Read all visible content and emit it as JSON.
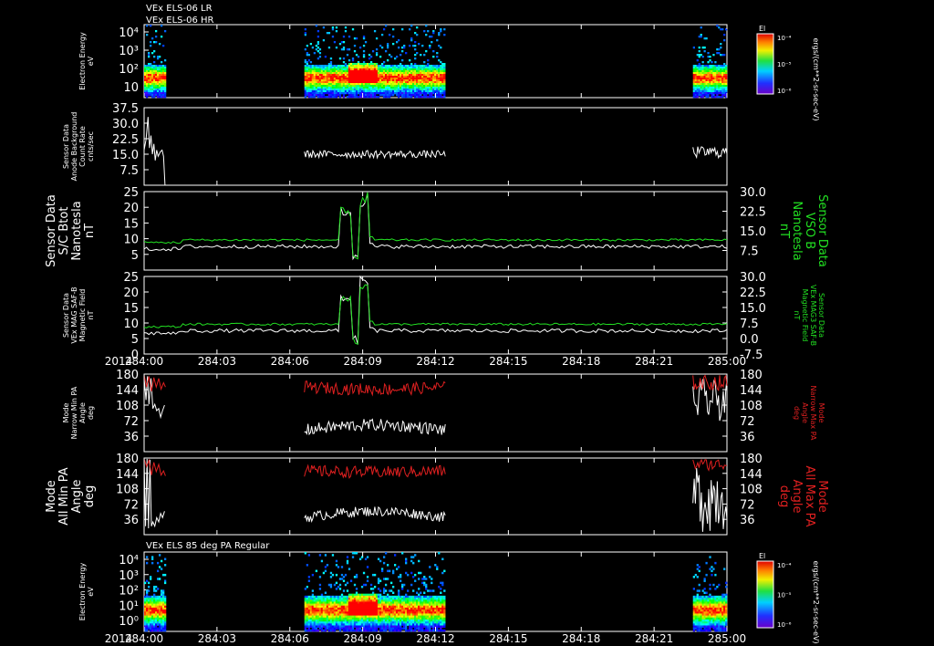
{
  "header": {
    "lines": [
      "VEx ELS-06 LR",
      "VEx ELS-06 HR"
    ]
  },
  "cbar_unit": "ergs/(cm**2-sr-sec-eV)",
  "cbar_label": "El",
  "cbar_ticks": [
    "10⁻⁴",
    "10⁻⁵",
    "10⁻⁶"
  ],
  "time_axis": {
    "year": "2014",
    "ticks": [
      "284:00",
      "284:03",
      "284:06",
      "284:09",
      "284:12",
      "284:15",
      "284:18",
      "284:21",
      "285:00"
    ]
  },
  "chart_data": [
    {
      "type": "heatmap",
      "name": "spec-top",
      "ylabel": [
        "Electron Energy",
        "eV"
      ],
      "log_y": true,
      "yticks": [
        "10⁴",
        "10³",
        "10²",
        "10"
      ],
      "colorscale": "rainbow",
      "segments": [
        [
          0,
          4.5
        ],
        [
          33,
          62
        ],
        [
          113,
          120
        ]
      ]
    },
    {
      "type": "line",
      "name": "bkg",
      "ylabel": [
        "Sensor Data",
        "Anode Background",
        "Count Rate",
        "cnts/sec"
      ],
      "ylim": [
        0,
        37.5
      ],
      "yticks": [
        "37.5",
        "30.0",
        "22.5",
        "15.0",
        "7.5"
      ],
      "ytick_values": [
        37.5,
        30,
        22.5,
        15,
        7.5
      ],
      "series": [
        {
          "color": "#ffffff",
          "segments": [
            {
              "x0": 0,
              "x1": 4.5,
              "points": [
                [
                  0,
                  17
                ],
                [
                  0.4,
                  22
                ],
                [
                  0.8,
                  33
                ],
                [
                  1.1,
                  18
                ],
                [
                  1.4,
                  24
                ],
                [
                  1.7,
                  15
                ],
                [
                  2.0,
                  20
                ],
                [
                  2.3,
                  12
                ],
                [
                  2.6,
                  17
                ],
                [
                  2.9,
                  14
                ],
                [
                  3.3,
                  16
                ],
                [
                  3.7,
                  17
                ],
                [
                  4.0,
                  14
                ],
                [
                  4.3,
                  0
                ]
              ]
            },
            {
              "x0": 33,
              "x1": 62,
              "base": 15,
              "amp": 1.8
            },
            {
              "x0": 113,
              "x1": 120,
              "base": 16,
              "amp": 2.8
            }
          ]
        }
      ]
    },
    {
      "type": "line",
      "name": "bmag1",
      "ylabel": [
        "Sensor Data",
        "S/C Btot",
        "Nanotesla",
        "nT"
      ],
      "ylim": [
        0,
        25
      ],
      "yticks": [
        "25",
        "20",
        "15",
        "10",
        "5"
      ],
      "ytick_values": [
        25,
        20,
        15,
        10,
        5
      ],
      "y2label": [
        "Sensor Data",
        "VSO B",
        "Nanotesla",
        "nT"
      ],
      "y2lim": [
        0,
        30
      ],
      "y2ticks": [
        "30.0",
        "22.5",
        "15.0",
        "7.5"
      ],
      "y2tick_values": [
        30,
        22.5,
        15,
        7.5
      ],
      "series": [
        {
          "color": "#ffffff",
          "base": 7.5,
          "amp": 0.6
        },
        {
          "color": "#22e022",
          "base": 9.6,
          "amp": 0.35
        }
      ]
    },
    {
      "type": "line",
      "name": "bmag2",
      "ylabel": [
        "Sensor Data",
        "VEx MAG SAF-B",
        "Magnetic Field",
        "nT"
      ],
      "ylim": [
        0,
        25
      ],
      "yticks": [
        "25",
        "20",
        "15",
        "10",
        "5",
        "0"
      ],
      "ytick_values": [
        25,
        20,
        15,
        10,
        5,
        0
      ],
      "y2label": [
        "Sensor Data",
        "VEx MAG3 SAF-B",
        "Magnetic Field",
        "nT"
      ],
      "y2lim": [
        -7.5,
        30
      ],
      "y2ticks": [
        "30.0",
        "22.5",
        "15.0",
        "7.5",
        "0.0",
        "-7.5"
      ],
      "y2tick_values": [
        30,
        22.5,
        15,
        7.5,
        0,
        -7.5
      ],
      "series": [
        {
          "color": "#ffffff",
          "base": 7.5,
          "amp": 0.6
        },
        {
          "color": "#22e022",
          "base": 9.6,
          "amp": 0.35
        }
      ]
    },
    {
      "type": "line",
      "name": "pa-narrow",
      "ylabel": [
        "Mode",
        "Narrow Min PA",
        "Angle",
        "deg"
      ],
      "ylim": [
        0,
        180
      ],
      "yticks": [
        "180",
        "144",
        "108",
        "72",
        "36"
      ],
      "ytick_values": [
        180,
        144,
        108,
        72,
        36
      ],
      "y2label": [
        "Mode",
        "Narrow Max PA",
        "Angle",
        "deg"
      ],
      "y2ticks": [
        "180",
        "144",
        "108",
        "72",
        "36"
      ],
      "series": [
        {
          "color": "#ffffff",
          "segments": [
            {
              "x0": 0,
              "x1": 4.5,
              "points": [
                [
                  0,
                  170
                ],
                [
                  0.4,
                  120
                ],
                [
                  0.7,
                  175
                ],
                [
                  1.0,
                  110
                ],
                [
                  1.4,
                  170
                ],
                [
                  1.8,
                  100
                ],
                [
                  2.2,
                  110
                ],
                [
                  2.6,
                  95
                ],
                [
                  3.0,
                  100
                ],
                [
                  3.4,
                  80
                ],
                [
                  3.8,
                  95
                ],
                [
                  4.2,
                  108
                ]
              ]
            },
            {
              "x0": 33,
              "x1": 62,
              "base": 50,
              "amp": 14,
              "trend": 12
            },
            {
              "x0": 113,
              "x1": 120,
              "base": 120,
              "amp": 50
            }
          ]
        },
        {
          "color": "#e02020",
          "segments": [
            {
              "x0": 0,
              "x1": 4.5,
              "points": [
                [
                  0,
                  178
                ],
                [
                  0.5,
                  150
                ],
                [
                  1.0,
                  175
                ],
                [
                  1.5,
                  140
                ],
                [
                  2.0,
                  172
                ],
                [
                  2.5,
                  150
                ],
                [
                  3.0,
                  170
                ],
                [
                  3.5,
                  145
                ],
                [
                  4.0,
                  160
                ],
                [
                  4.4,
                  150
                ]
              ]
            },
            {
              "x0": 33,
              "x1": 62,
              "base": 150,
              "amp": 14,
              "trend": -5
            },
            {
              "x0": 113,
              "x1": 120,
              "base": 160,
              "amp": 18
            }
          ]
        }
      ]
    },
    {
      "type": "line",
      "name": "pa-all",
      "ylabel": [
        "Mode",
        "All Min PA",
        "Angle",
        "deg"
      ],
      "ylim": [
        0,
        180
      ],
      "yticks": [
        "180",
        "144",
        "108",
        "72",
        "36"
      ],
      "ytick_values": [
        180,
        144,
        108,
        72,
        36
      ],
      "y2label": [
        "Mode",
        "All Max PA",
        "Angle",
        "deg"
      ],
      "y2ticks": [
        "180",
        "144",
        "108",
        "72",
        "36"
      ],
      "series": [
        {
          "color": "#ffffff",
          "segments": [
            {
              "x0": 0,
              "x1": 4.5,
              "points": [
                [
                  0,
                  175
                ],
                [
                  0.3,
                  20
                ],
                [
                  0.6,
                  178
                ],
                [
                  0.9,
                  15
                ],
                [
                  1.2,
                  176
                ],
                [
                  1.5,
                  20
                ],
                [
                  1.8,
                  30
                ],
                [
                  2.2,
                  20
                ],
                [
                  2.6,
                  40
                ],
                [
                  3.0,
                  30
                ],
                [
                  3.4,
                  50
                ],
                [
                  3.8,
                  40
                ],
                [
                  4.2,
                  55
                ]
              ]
            },
            {
              "x0": 33,
              "x1": 62,
              "base": 40,
              "amp": 12,
              "trend": 15
            },
            {
              "x0": 113,
              "x1": 120,
              "base": 90,
              "amp": 85
            }
          ]
        },
        {
          "color": "#e02020",
          "segments": [
            {
              "x0": 0,
              "x1": 4.5,
              "points": [
                [
                  0,
                  178
                ],
                [
                  0.5,
                  160
                ],
                [
                  1.0,
                  175
                ],
                [
                  1.5,
                  140
                ],
                [
                  2.0,
                  170
                ],
                [
                  2.5,
                  148
                ],
                [
                  3.0,
                  165
                ],
                [
                  3.5,
                  140
                ],
                [
                  4.0,
                  150
                ],
                [
                  4.4,
                  138
                ]
              ]
            },
            {
              "x0": 33,
              "x1": 62,
              "base": 150,
              "amp": 14,
              "trend": -3
            },
            {
              "x0": 113,
              "x1": 120,
              "base": 165,
              "amp": 14
            }
          ]
        }
      ]
    },
    {
      "type": "heatmap",
      "name": "spec-bottom",
      "title": "VEx ELS 85 deg PA Regular",
      "ylabel": [
        "Electron Energy",
        "eV"
      ],
      "log_y": true,
      "yticks": [
        "10⁴",
        "10³",
        "10²",
        "10¹",
        "10⁰"
      ],
      "colorscale": "rainbow",
      "segments": [
        [
          0,
          4.5
        ],
        [
          33,
          62
        ],
        [
          113,
          120
        ]
      ]
    }
  ]
}
